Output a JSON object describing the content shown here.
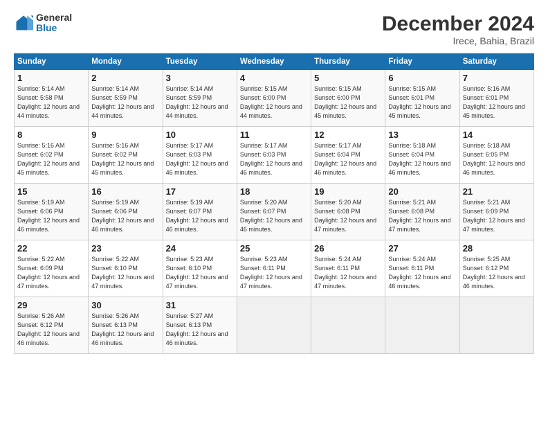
{
  "logo": {
    "general": "General",
    "blue": "Blue"
  },
  "title": "December 2024",
  "subtitle": "Irece, Bahia, Brazil",
  "weekdays": [
    "Sunday",
    "Monday",
    "Tuesday",
    "Wednesday",
    "Thursday",
    "Friday",
    "Saturday"
  ],
  "weeks": [
    [
      {
        "day": 1,
        "sunrise": "5:14 AM",
        "sunset": "5:58 PM",
        "daylight": "12 hours and 44 minutes."
      },
      {
        "day": 2,
        "sunrise": "5:14 AM",
        "sunset": "5:59 PM",
        "daylight": "12 hours and 44 minutes."
      },
      {
        "day": 3,
        "sunrise": "5:14 AM",
        "sunset": "5:59 PM",
        "daylight": "12 hours and 44 minutes."
      },
      {
        "day": 4,
        "sunrise": "5:15 AM",
        "sunset": "6:00 PM",
        "daylight": "12 hours and 44 minutes."
      },
      {
        "day": 5,
        "sunrise": "5:15 AM",
        "sunset": "6:00 PM",
        "daylight": "12 hours and 45 minutes."
      },
      {
        "day": 6,
        "sunrise": "5:15 AM",
        "sunset": "6:01 PM",
        "daylight": "12 hours and 45 minutes."
      },
      {
        "day": 7,
        "sunrise": "5:16 AM",
        "sunset": "6:01 PM",
        "daylight": "12 hours and 45 minutes."
      }
    ],
    [
      {
        "day": 8,
        "sunrise": "5:16 AM",
        "sunset": "6:02 PM",
        "daylight": "12 hours and 45 minutes."
      },
      {
        "day": 9,
        "sunrise": "5:16 AM",
        "sunset": "6:02 PM",
        "daylight": "12 hours and 45 minutes."
      },
      {
        "day": 10,
        "sunrise": "5:17 AM",
        "sunset": "6:03 PM",
        "daylight": "12 hours and 46 minutes."
      },
      {
        "day": 11,
        "sunrise": "5:17 AM",
        "sunset": "6:03 PM",
        "daylight": "12 hours and 46 minutes."
      },
      {
        "day": 12,
        "sunrise": "5:17 AM",
        "sunset": "6:04 PM",
        "daylight": "12 hours and 46 minutes."
      },
      {
        "day": 13,
        "sunrise": "5:18 AM",
        "sunset": "6:04 PM",
        "daylight": "12 hours and 46 minutes."
      },
      {
        "day": 14,
        "sunrise": "5:18 AM",
        "sunset": "6:05 PM",
        "daylight": "12 hours and 46 minutes."
      }
    ],
    [
      {
        "day": 15,
        "sunrise": "5:19 AM",
        "sunset": "6:06 PM",
        "daylight": "12 hours and 46 minutes."
      },
      {
        "day": 16,
        "sunrise": "5:19 AM",
        "sunset": "6:06 PM",
        "daylight": "12 hours and 46 minutes."
      },
      {
        "day": 17,
        "sunrise": "5:19 AM",
        "sunset": "6:07 PM",
        "daylight": "12 hours and 46 minutes."
      },
      {
        "day": 18,
        "sunrise": "5:20 AM",
        "sunset": "6:07 PM",
        "daylight": "12 hours and 46 minutes."
      },
      {
        "day": 19,
        "sunrise": "5:20 AM",
        "sunset": "6:08 PM",
        "daylight": "12 hours and 47 minutes."
      },
      {
        "day": 20,
        "sunrise": "5:21 AM",
        "sunset": "6:08 PM",
        "daylight": "12 hours and 47 minutes."
      },
      {
        "day": 21,
        "sunrise": "5:21 AM",
        "sunset": "6:09 PM",
        "daylight": "12 hours and 47 minutes."
      }
    ],
    [
      {
        "day": 22,
        "sunrise": "5:22 AM",
        "sunset": "6:09 PM",
        "daylight": "12 hours and 47 minutes."
      },
      {
        "day": 23,
        "sunrise": "5:22 AM",
        "sunset": "6:10 PM",
        "daylight": "12 hours and 47 minutes."
      },
      {
        "day": 24,
        "sunrise": "5:23 AM",
        "sunset": "6:10 PM",
        "daylight": "12 hours and 47 minutes."
      },
      {
        "day": 25,
        "sunrise": "5:23 AM",
        "sunset": "6:11 PM",
        "daylight": "12 hours and 47 minutes."
      },
      {
        "day": 26,
        "sunrise": "5:24 AM",
        "sunset": "6:11 PM",
        "daylight": "12 hours and 47 minutes."
      },
      {
        "day": 27,
        "sunrise": "5:24 AM",
        "sunset": "6:11 PM",
        "daylight": "12 hours and 46 minutes."
      },
      {
        "day": 28,
        "sunrise": "5:25 AM",
        "sunset": "6:12 PM",
        "daylight": "12 hours and 46 minutes."
      }
    ],
    [
      {
        "day": 29,
        "sunrise": "5:26 AM",
        "sunset": "6:12 PM",
        "daylight": "12 hours and 46 minutes."
      },
      {
        "day": 30,
        "sunrise": "5:26 AM",
        "sunset": "6:13 PM",
        "daylight": "12 hours and 46 minutes."
      },
      {
        "day": 31,
        "sunrise": "5:27 AM",
        "sunset": "6:13 PM",
        "daylight": "12 hours and 46 minutes."
      },
      null,
      null,
      null,
      null
    ]
  ]
}
